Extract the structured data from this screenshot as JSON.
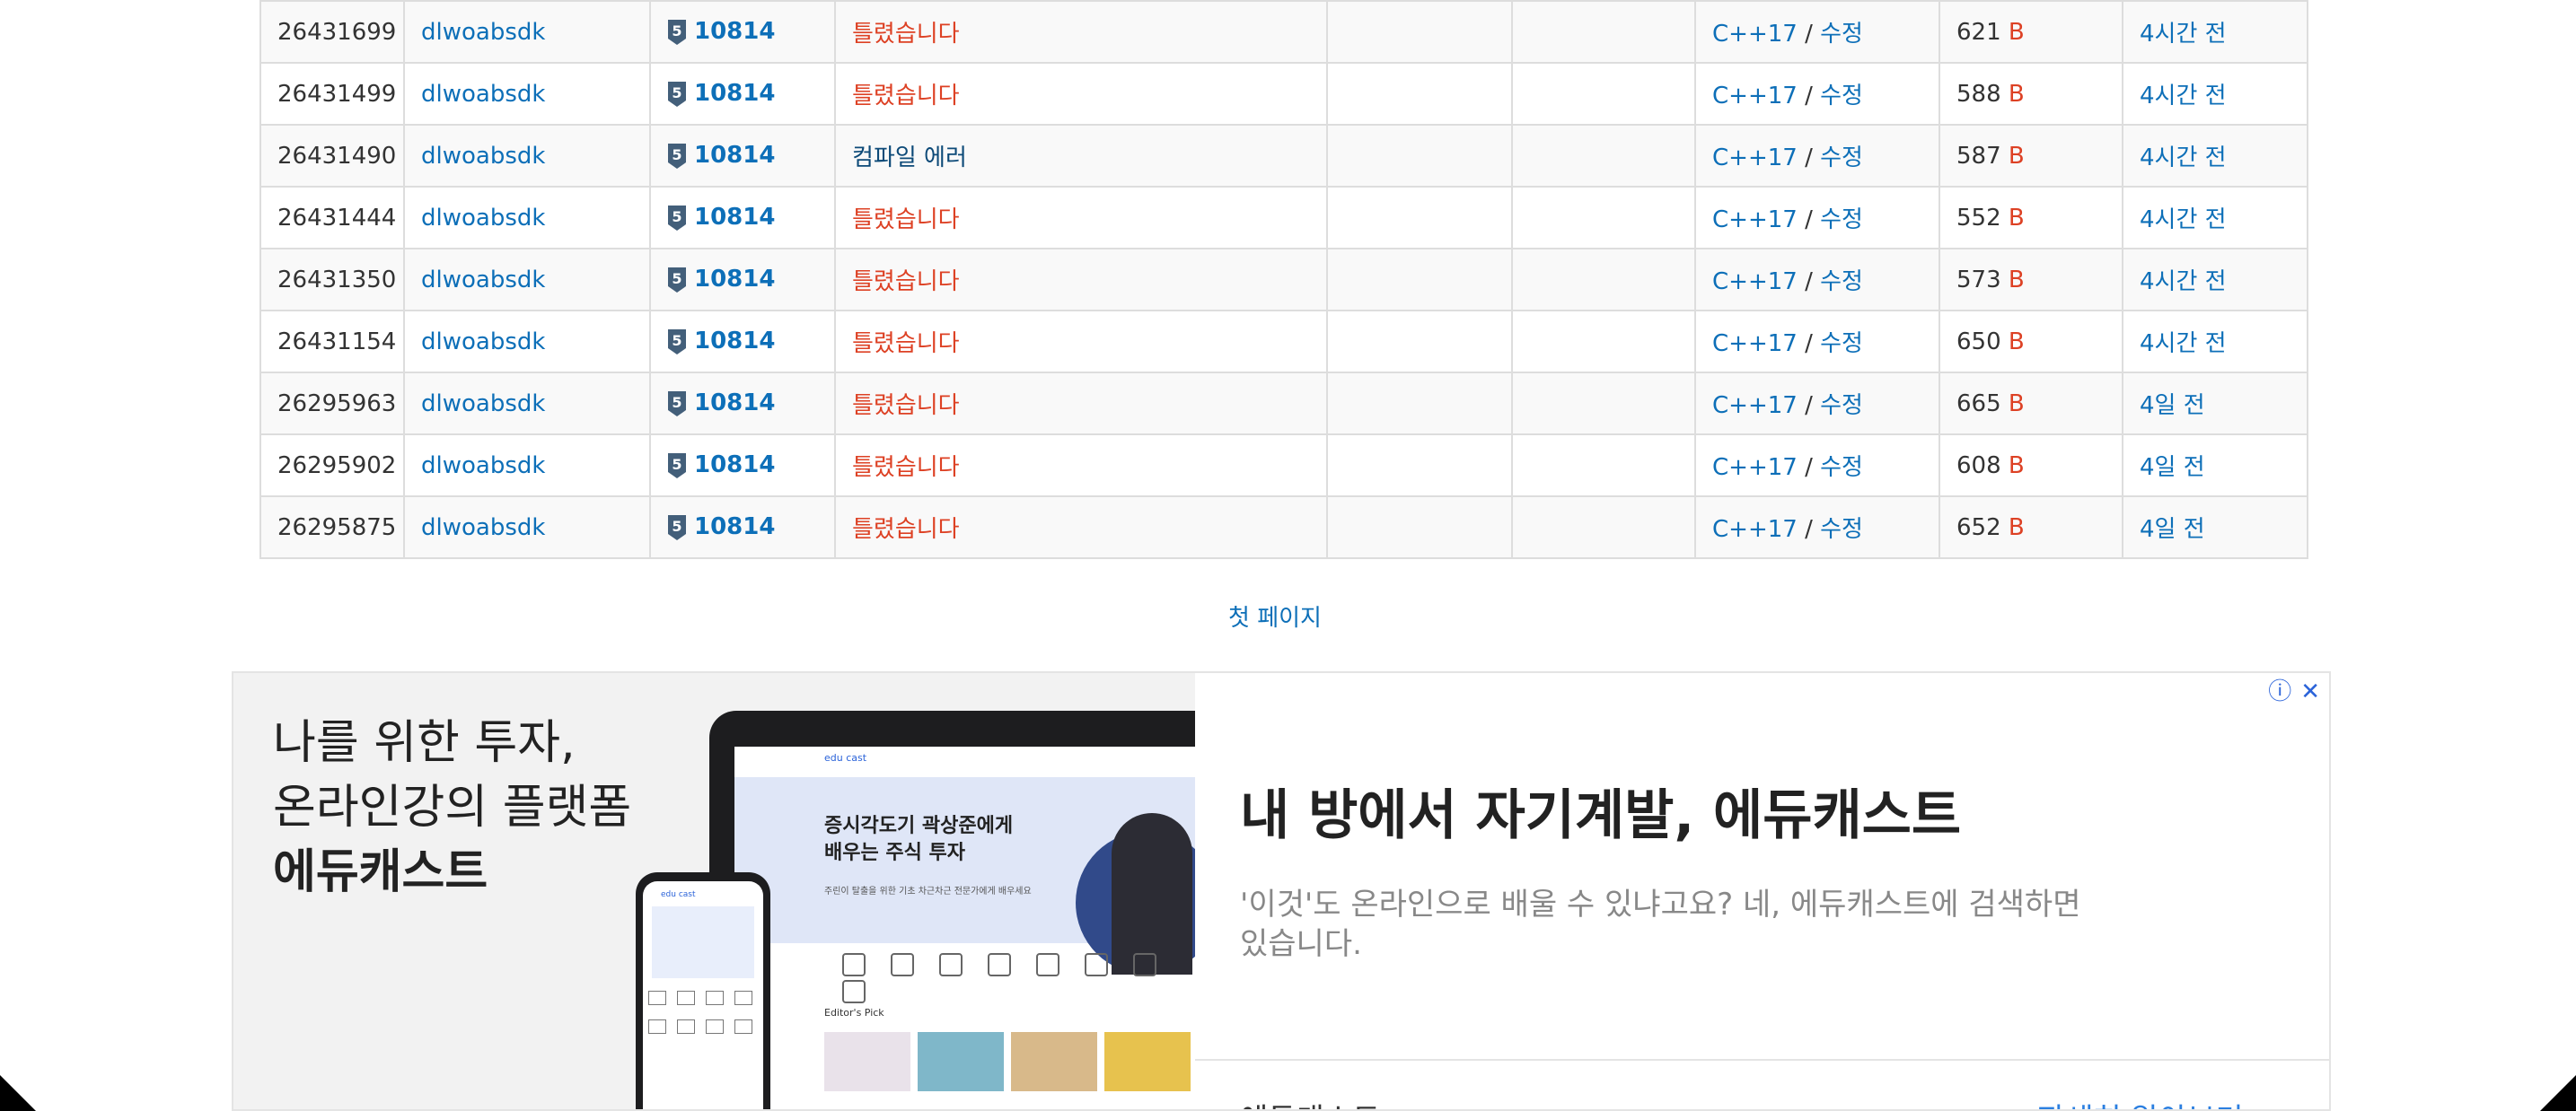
{
  "table": {
    "rows": [
      {
        "id": "26431699",
        "user": "dlwoabsdk",
        "problem": "10814",
        "result": "틀렸습니다",
        "result_type": "wrong",
        "memory": "",
        "time": "",
        "language": "C++17",
        "edit": "수정",
        "code_length": "621",
        "length_unit": "B",
        "submitted": "4시간 전"
      },
      {
        "id": "26431499",
        "user": "dlwoabsdk",
        "problem": "10814",
        "result": "틀렸습니다",
        "result_type": "wrong",
        "memory": "",
        "time": "",
        "language": "C++17",
        "edit": "수정",
        "code_length": "588",
        "length_unit": "B",
        "submitted": "4시간 전"
      },
      {
        "id": "26431490",
        "user": "dlwoabsdk",
        "problem": "10814",
        "result": "컴파일 에러",
        "result_type": "compile-error",
        "memory": "",
        "time": "",
        "language": "C++17",
        "edit": "수정",
        "code_length": "587",
        "length_unit": "B",
        "submitted": "4시간 전"
      },
      {
        "id": "26431444",
        "user": "dlwoabsdk",
        "problem": "10814",
        "result": "틀렸습니다",
        "result_type": "wrong",
        "memory": "",
        "time": "",
        "language": "C++17",
        "edit": "수정",
        "code_length": "552",
        "length_unit": "B",
        "submitted": "4시간 전"
      },
      {
        "id": "26431350",
        "user": "dlwoabsdk",
        "problem": "10814",
        "result": "틀렸습니다",
        "result_type": "wrong",
        "memory": "",
        "time": "",
        "language": "C++17",
        "edit": "수정",
        "code_length": "573",
        "length_unit": "B",
        "submitted": "4시간 전"
      },
      {
        "id": "26431154",
        "user": "dlwoabsdk",
        "problem": "10814",
        "result": "틀렸습니다",
        "result_type": "wrong",
        "memory": "",
        "time": "",
        "language": "C++17",
        "edit": "수정",
        "code_length": "650",
        "length_unit": "B",
        "submitted": "4시간 전"
      },
      {
        "id": "26295963",
        "user": "dlwoabsdk",
        "problem": "10814",
        "result": "틀렸습니다",
        "result_type": "wrong",
        "memory": "",
        "time": "",
        "language": "C++17",
        "edit": "수정",
        "code_length": "665",
        "length_unit": "B",
        "submitted": "4일 전"
      },
      {
        "id": "26295902",
        "user": "dlwoabsdk",
        "problem": "10814",
        "result": "틀렸습니다",
        "result_type": "wrong",
        "memory": "",
        "time": "",
        "language": "C++17",
        "edit": "수정",
        "code_length": "608",
        "length_unit": "B",
        "submitted": "4일 전"
      },
      {
        "id": "26295875",
        "user": "dlwoabsdk",
        "problem": "10814",
        "result": "틀렸습니다",
        "result_type": "wrong",
        "memory": "",
        "time": "",
        "language": "C++17",
        "edit": "수정",
        "code_length": "652",
        "length_unit": "B",
        "submitted": "4일 전"
      }
    ],
    "tier_badge": {
      "level": "5",
      "icon": "silver-tier-badge-icon",
      "color": "#435f7a"
    },
    "colors": {
      "wrong": "#dd4124",
      "compile_error": "#0d4a78",
      "link": "#0d6fb8",
      "problem": "#2a9d5c"
    }
  },
  "pagination": {
    "first_page": "첫 페이지"
  },
  "ad": {
    "headline_lines": [
      "나를 위한 투자,",
      "온라인강의 플랫폼"
    ],
    "headline_brand": "에듀캐스트",
    "laptop_screen": {
      "logo": "edu cast",
      "hero_title_1": "증시각도기 곽상준에게",
      "hero_title_2": "배우는 주식 투자",
      "hero_sub": "주린이 탈출을 위한 기초 차근차근 전문가에게 배우세요",
      "picks_label": "Editor's Pick"
    },
    "title": "내 방에서 자기계발, 에듀캐스트",
    "description": "'이것'도 온라인으로 배울 수 있냐고요? 네, 에듀캐스트에 검색하면 있습니다.",
    "advertiser": "에듀캐스트",
    "cta": "자세히 알아보기 >",
    "info_icon": "info-icon",
    "close_icon": "close-icon"
  }
}
